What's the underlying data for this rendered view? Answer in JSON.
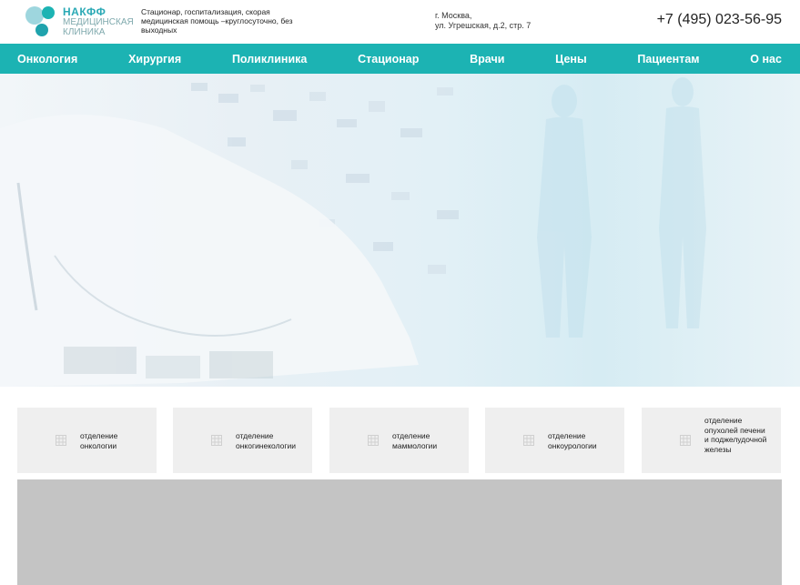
{
  "header": {
    "logo_line1": "НАКФФ",
    "logo_line2": "МЕДИЦИНСКАЯ",
    "logo_line3": "КЛИНИКА",
    "tagline": "Стационар, госпитализация, скорая медицинская помощь –круглосуточно, без выходных",
    "address_line1": "г. Москва,",
    "address_line2": "ул. Угрешская, д.2, стр. 7",
    "phone": "+7 (495) 023-56-95"
  },
  "nav": {
    "items": [
      {
        "label": "Онкология"
      },
      {
        "label": "Хирургия"
      },
      {
        "label": "Поликлиника"
      },
      {
        "label": "Стационар"
      },
      {
        "label": "Врачи"
      },
      {
        "label": "Цены"
      },
      {
        "label": "Пациентам"
      },
      {
        "label": "О нас"
      }
    ]
  },
  "departments": [
    {
      "label": "отделение онкологии",
      "icon": "grid-icon"
    },
    {
      "label": "отделение онкогинекологии",
      "icon": "grid-icon"
    },
    {
      "label": "отделение маммологии",
      "icon": "grid-icon"
    },
    {
      "label": "отделение онкоурологии",
      "icon": "grid-icon"
    },
    {
      "label": "отделение опухолей печени и поджелудочной железы",
      "icon": "grid-icon"
    }
  ],
  "colors": {
    "brand": "#1cb3b3",
    "logo_accent": "#2aa9b5",
    "card_bg": "#efefef",
    "placeholder_bg": "#c4c4c4"
  }
}
